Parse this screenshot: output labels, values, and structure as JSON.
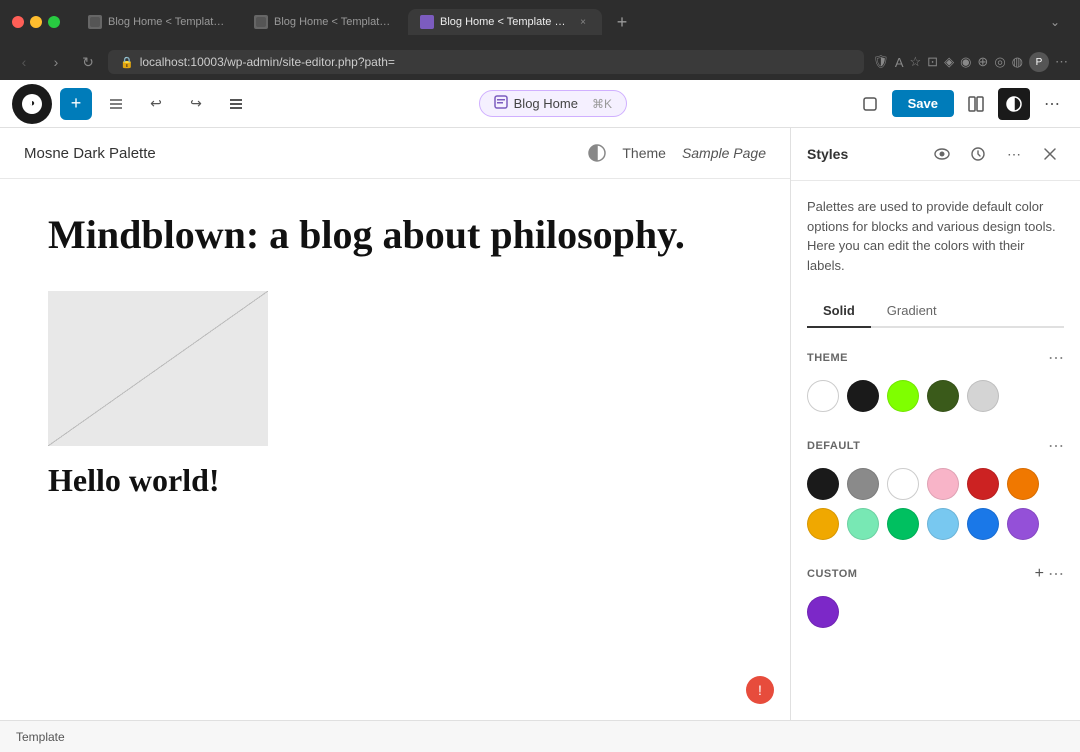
{
  "browser": {
    "tabs": [
      {
        "id": 1,
        "label": "Blog Home < Template < M",
        "active": false
      },
      {
        "id": 2,
        "label": "Blog Home < Template < M",
        "active": false
      },
      {
        "id": 3,
        "label": "Blog Home < Template < M",
        "active": true
      }
    ],
    "address": "localhost:10003/wp-admin/site-editor.php?path=",
    "add_tab_label": "+",
    "chevron_label": "⌄"
  },
  "nav": {
    "back_label": "‹",
    "forward_label": "›",
    "reload_label": "↻",
    "add_btn_label": "+",
    "undo_icon": "↩",
    "redo_icon": "↪",
    "list_icon": "☰",
    "breadcrumb_icon": "⊟",
    "breadcrumb_label": "Blog Home",
    "shortcut_label": "⌘K",
    "save_label": "Save",
    "view_icon": "□",
    "layout_icon": "⊞",
    "style_icon": "◑",
    "more_icon": "⋯"
  },
  "site": {
    "name": "Mosne Dark Palette",
    "theme_label": "Theme",
    "sample_page_label": "Sample Page",
    "blog_title": "Mindblown: a blog about philosophy.",
    "post_title": "Hello world!"
  },
  "bottom_bar": {
    "template_label": "Template"
  },
  "styles_panel": {
    "title": "Styles",
    "eye_icon": "👁",
    "history_icon": "🕐",
    "more_icon": "⋯",
    "close_icon": "×",
    "description": "Palettes are used to provide default color options for blocks and various design tools. Here you can edit the colors with their labels.",
    "tabs": [
      {
        "id": "solid",
        "label": "Solid",
        "active": true
      },
      {
        "id": "gradient",
        "label": "Gradient",
        "active": false
      }
    ],
    "theme_section": {
      "title": "THEME",
      "colors": [
        {
          "id": "white",
          "class": "white",
          "label": "White"
        },
        {
          "id": "black",
          "class": "black",
          "label": "Black"
        },
        {
          "id": "lime",
          "class": "lime",
          "label": "Lime"
        },
        {
          "id": "dark-green",
          "class": "dark-green",
          "label": "Dark Green"
        },
        {
          "id": "light-gray",
          "class": "light-gray",
          "label": "Light Gray"
        }
      ]
    },
    "default_section": {
      "title": "DEFAULT",
      "colors": [
        {
          "id": "def-black",
          "class": "def-black",
          "label": "Black"
        },
        {
          "id": "gray",
          "class": "gray",
          "label": "Gray"
        },
        {
          "id": "def-white",
          "class": "def-white",
          "label": "White"
        },
        {
          "id": "pink",
          "class": "pink",
          "label": "Pink"
        },
        {
          "id": "red",
          "class": "red",
          "label": "Red"
        },
        {
          "id": "orange",
          "class": "orange",
          "label": "Orange"
        },
        {
          "id": "yellow",
          "class": "yellow",
          "label": "Yellow"
        },
        {
          "id": "mint",
          "class": "mint",
          "label": "Mint"
        },
        {
          "id": "green",
          "class": "green",
          "label": "Green"
        },
        {
          "id": "sky",
          "class": "sky",
          "label": "Sky"
        },
        {
          "id": "blue",
          "class": "blue",
          "label": "Blue"
        },
        {
          "id": "purple",
          "class": "purple",
          "label": "Purple"
        }
      ]
    },
    "custom_section": {
      "title": "CUSTOM",
      "colors": [
        {
          "id": "custom-purple",
          "class": "custom-purple",
          "label": "Custom Purple"
        }
      ]
    }
  },
  "error": {
    "icon": "!"
  }
}
